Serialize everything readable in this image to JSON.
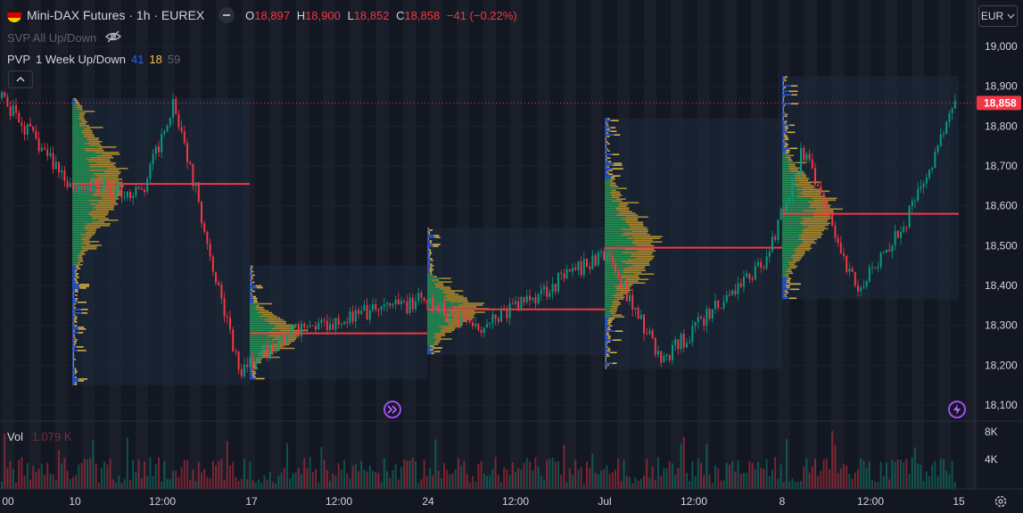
{
  "header": {
    "symbol_title": "Mini-DAX Futures · 1h · EUREX",
    "ohlc": [
      {
        "label": "O",
        "value": "18,897"
      },
      {
        "label": "H",
        "value": "18,900"
      },
      {
        "label": "L",
        "value": "18,852"
      },
      {
        "label": "C",
        "value": "18,858"
      }
    ],
    "change": "−41 (−0.22%)",
    "flag_icon": "germany-flag-icon",
    "collapse_icon": "minus-icon"
  },
  "indicators": {
    "svp": {
      "label": "SVP All Up/Down",
      "icon": "eye-crossed-icon"
    },
    "pvp": {
      "label": "PVP",
      "params": "1 Week Up/Down",
      "p1": "41",
      "p2": "18",
      "p3": "59"
    },
    "collapse_button_icon": "chevron-up-icon"
  },
  "currency": "EUR",
  "volume": {
    "label": "Vol",
    "value": "1.079 K"
  },
  "price_axis": {
    "ticks": [
      "19,000",
      "18,900",
      "18,800",
      "18,700",
      "18,600",
      "18,500",
      "18,400",
      "18,300",
      "18,200",
      "18,100"
    ],
    "current_price": "18,858"
  },
  "volume_axis": {
    "ticks": [
      "8K",
      "4K"
    ]
  },
  "time_axis": {
    "ticks": [
      "00",
      "10",
      "12:00",
      "17",
      "12:00",
      "24",
      "12:00",
      "Jul",
      "12:00",
      "8",
      "12:00",
      "15"
    ]
  },
  "buttons": {
    "replay_icon": "fast-forward-icon",
    "lightning_icon": "lightning-icon",
    "settings_icon": "gear-icon"
  },
  "colors": {
    "background": "#131722",
    "up": "#089981",
    "down": "#f23645",
    "poc": "#f23645",
    "profile_up": "#2962ff",
    "profile_down": "#f7c548",
    "value_area_up": "#26a65b",
    "value_area_down": "#c39b2e",
    "box": "#1e2a3a"
  },
  "chart_data": {
    "type": "candlestick",
    "title": "Mini-DAX Futures · 1h · EUREX",
    "ylim": [
      18080,
      19050
    ],
    "x_ticks": [
      "00",
      "10",
      "12:00",
      "17",
      "12:00",
      "24",
      "12:00",
      "Jul",
      "12:00",
      "8",
      "12:00",
      "15"
    ],
    "weekly_profiles": [
      {
        "week": "10",
        "high": 18870,
        "low": 18150,
        "poc": 18655
      },
      {
        "week": "17",
        "high": 18450,
        "low": 18165,
        "poc": 18280
      },
      {
        "week": "24",
        "high": 18545,
        "low": 18225,
        "poc": 18340
      },
      {
        "week": "Jul",
        "high": 18820,
        "low": 18190,
        "poc": 18495
      },
      {
        "week": "8",
        "high": 18925,
        "low": 18365,
        "poc": 18580
      }
    ],
    "price_path": [
      {
        "x": "00",
        "y": 18870
      },
      {
        "x": "10",
        "y": 18650
      },
      {
        "x": "12:00",
        "y": 18630
      },
      {
        "x": "mid",
        "y": 18870
      },
      {
        "x": "17",
        "y": 18180
      },
      {
        "x": "12:00",
        "y": 18290
      },
      {
        "x": "24",
        "y": 18360
      },
      {
        "x": "12:00",
        "y": 18300
      },
      {
        "x": "Jul",
        "y": 18480
      },
      {
        "x": "low",
        "y": 18210
      },
      {
        "x": "12:00",
        "y": 18470
      },
      {
        "x": "8",
        "y": 18740
      },
      {
        "x": "low",
        "y": 18390
      },
      {
        "x": "12:00",
        "y": 18580
      },
      {
        "x": "15",
        "y": 18858
      }
    ],
    "last_close": 18858
  }
}
